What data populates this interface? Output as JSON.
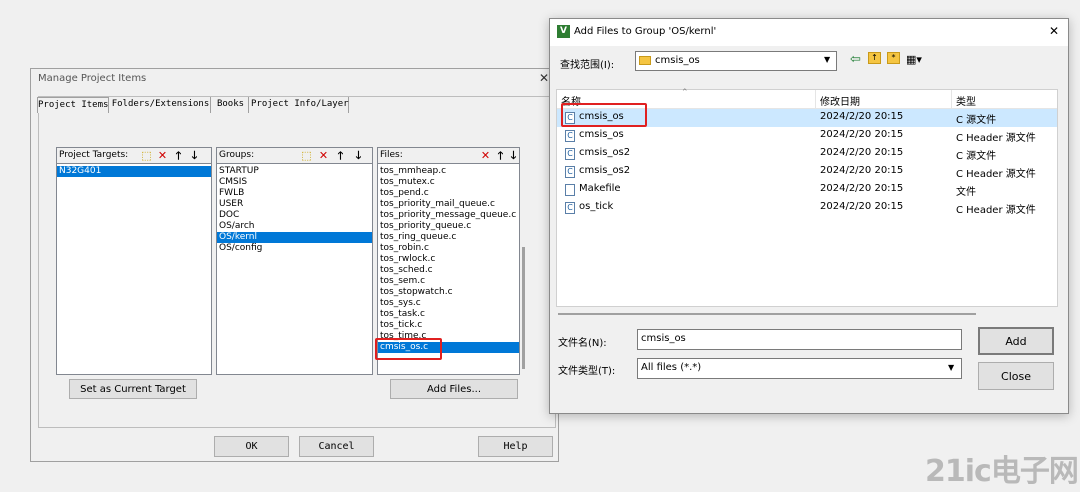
{
  "manage": {
    "title": "Manage Project Items",
    "close": "✕",
    "tabs": [
      "Project Items",
      "Folders/Extensions",
      "Books",
      "Project Info/Layer"
    ],
    "targets_label": "Project Targets:",
    "targets": [
      "N32G401"
    ],
    "groups_label": "Groups:",
    "groups": [
      "STARTUP",
      "CMSIS",
      "FWLB",
      "USER",
      "DOC",
      "OS/arch",
      "OS/kernl",
      "OS/config"
    ],
    "files_label": "Files:",
    "files": [
      "tos_mmheap.c",
      "tos_mutex.c",
      "tos_pend.c",
      "tos_priority_mail_queue.c",
      "tos_priority_message_queue.c",
      "tos_priority_queue.c",
      "tos_ring_queue.c",
      "tos_robin.c",
      "tos_rwlock.c",
      "tos_sched.c",
      "tos_sem.c",
      "tos_stopwatch.c",
      "tos_sys.c",
      "tos_task.c",
      "tos_tick.c",
      "tos_time.c",
      "cmsis_os.c"
    ],
    "set_target": "Set as Current Target",
    "add_files": "Add Files...",
    "ok": "OK",
    "cancel": "Cancel",
    "help": "Help"
  },
  "addfiles": {
    "title": "Add Files to Group 'OS/kernl'",
    "close": "✕",
    "lookin_label": "查找范围(I):",
    "lookin_value": "cmsis_os",
    "col_name": "名称",
    "col_date": "修改日期",
    "col_type": "类型",
    "rows": [
      {
        "name": "cmsis_os",
        "date": "2024/2/20 20:15",
        "type": "C 源文件",
        "icon": "c-file-icon"
      },
      {
        "name": "cmsis_os",
        "date": "2024/2/20 20:15",
        "type": "C Header 源文件",
        "icon": "c-file-icon"
      },
      {
        "name": "cmsis_os2",
        "date": "2024/2/20 20:15",
        "type": "C 源文件",
        "icon": "c-file-icon"
      },
      {
        "name": "cmsis_os2",
        "date": "2024/2/20 20:15",
        "type": "C Header 源文件",
        "icon": "c-file-icon"
      },
      {
        "name": "Makefile",
        "date": "2024/2/20 20:15",
        "type": "文件",
        "icon": "file-icon"
      },
      {
        "name": "os_tick",
        "date": "2024/2/20 20:15",
        "type": "C Header 源文件",
        "icon": "c-file-icon"
      }
    ],
    "filename_label": "文件名(N):",
    "filename_value": "cmsis_os",
    "filetype_label": "文件类型(T):",
    "filetype_value": "All files (*.*)",
    "add": "Add",
    "close_btn": "Close"
  },
  "watermark": {
    "text": "21ic电子网"
  },
  "colors": {
    "select": "#0078d7",
    "highlight_box": "#e02020",
    "row_select": "#cce8ff"
  }
}
